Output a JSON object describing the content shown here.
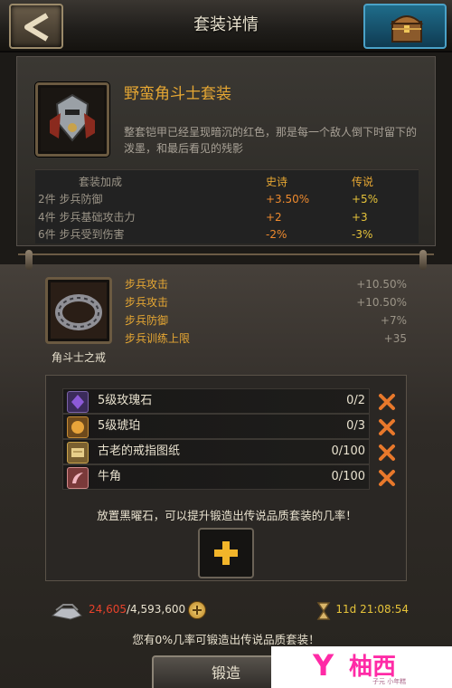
{
  "header": {
    "title": "套装详情",
    "back_icon": "chevron-left-icon",
    "chest_icon": "treasure-chest-icon"
  },
  "set": {
    "name": "野蛮角斗士套装",
    "description": "整套铠甲已经呈现暗沉的红色，那是每一个敌人倒下时留下的泼墨，和最后看见的残影",
    "bonus_header": [
      "套装加成",
      "史诗",
      "传说"
    ],
    "bonuses": [
      {
        "label": "2件 步兵防御",
        "epic": "+3.50%",
        "legend": "+5%"
      },
      {
        "label": "4件 步兵基础攻击力",
        "epic": "+2",
        "legend": "+3"
      },
      {
        "label": "6件 步兵受到伤害",
        "epic": "-2%",
        "legend": "-3%"
      }
    ]
  },
  "item": {
    "name": "角斗士之戒",
    "stats": [
      {
        "label": "步兵攻击",
        "value": "+10.50%"
      },
      {
        "label": "步兵攻击",
        "value": "+10.50%"
      },
      {
        "label": "步兵防御",
        "value": "+7%"
      },
      {
        "label": "步兵训练上限",
        "value": "+35"
      }
    ]
  },
  "materials": [
    {
      "name": "5级玫瑰石",
      "count": "0/2",
      "icon": "rose-stone-icon"
    },
    {
      "name": "5级琥珀",
      "count": "0/3",
      "icon": "amber-icon"
    },
    {
      "name": "古老的戒指图纸",
      "count": "0/100",
      "icon": "scroll-icon"
    },
    {
      "name": "牛角",
      "count": "0/100",
      "icon": "horn-icon"
    }
  ],
  "hint": "放置黑曜石，可以提升锻造出传说品质套装的几率！",
  "resource": {
    "have": "24,605",
    "need": "/4,593,600"
  },
  "timer": "11d 21:08:54",
  "chance_text": "您有0%几率可锻造出传说品质套装！",
  "forge_label": "锻造",
  "watermark": {
    "logo": "Y",
    "name": "柚西",
    "sub": "子元 小年糕"
  },
  "colors": {
    "epic": "#ee8a2e",
    "legend": "#e6c33a",
    "title_gold": "#e6a733",
    "shortage": "#e8422b"
  }
}
